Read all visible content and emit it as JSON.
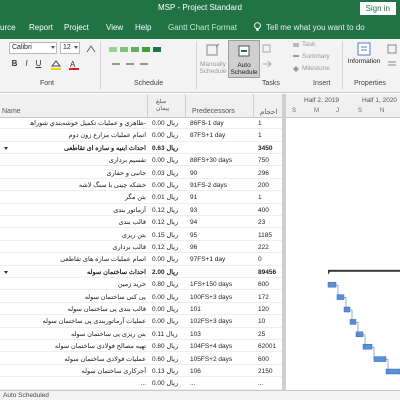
{
  "title": "MSP  -  Project Standard",
  "signin": "Sign in",
  "tabs": [
    "urce",
    "Report",
    "Project",
    "View",
    "Help",
    "Gantt Chart Format"
  ],
  "search_placeholder": "Tell me what you want to do",
  "ribbon": {
    "font_name": "Calibri",
    "font_size": "12",
    "manually_schedule": "Manually Schedule",
    "auto_schedule": "Auto Schedule",
    "task": "Task",
    "summary": "Summary",
    "milestone": "Milestone",
    "information": "Information",
    "groups": {
      "font": "Font",
      "schedule": "Schedule",
      "tasks": "Tasks",
      "insert": "Insert",
      "properties": "Properties"
    }
  },
  "columns": {
    "name": "Name",
    "duration": "مبلغ\nپیمان",
    "predecessors": "Predecessors",
    "cost": "احجام"
  },
  "timeline": {
    "half1": "Half 2, 2019",
    "half2": "Half 1, 2020",
    "days": [
      "S",
      "M",
      "J",
      "S",
      "N"
    ]
  },
  "rows": [
    {
      "name": "-ظاهري و عمليات تكميل خوشه‌بندي شوراهات",
      "dur": "ریال 0.00",
      "pred": "86FS-1 day",
      "cost": "1",
      "summary": false
    },
    {
      "name": "اتمام عملیات مزارع زون دوم",
      "dur": "ریال 0.00",
      "pred": "87FS+1 day",
      "cost": "1",
      "summary": false
    },
    {
      "name": "احداث ابنیه و سازه ای تقاطعی",
      "dur": "ریال 0.63",
      "pred": "",
      "cost": "3450",
      "summary": true
    },
    {
      "name": "تقسیم برداری",
      "dur": "ریال 0.00",
      "pred": "88FS+30 days",
      "cost": "750",
      "summary": false
    },
    {
      "name": "جانبی و حفاری",
      "dur": "ریال 0.03",
      "pred": "90",
      "cost": "296",
      "summary": false
    },
    {
      "name": "خشکه چینی با سنگ لاشه",
      "dur": "ریال 0.00",
      "pred": "91FS-2 days",
      "cost": "200",
      "summary": false
    },
    {
      "name": "بتن مگر",
      "dur": "ریال 0.01",
      "pred": "91",
      "cost": "1",
      "summary": false
    },
    {
      "name": "آرماتور بندی",
      "dur": "ریال 0.12",
      "pred": "93",
      "cost": "400",
      "summary": false
    },
    {
      "name": "قالب بندی",
      "dur": "ریال 0.12",
      "pred": "94",
      "cost": "23",
      "summary": false
    },
    {
      "name": "بتن ریزی",
      "dur": "ریال 0.15",
      "pred": "95",
      "cost": "1185",
      "summary": false
    },
    {
      "name": "قالب برداری",
      "dur": "ریال 0.12",
      "pred": "96",
      "cost": "222",
      "summary": false
    },
    {
      "name": "اتمام عملیات سازه های تقاطعی",
      "dur": "ریال 0.00",
      "pred": "97FS+1 day",
      "cost": "0",
      "summary": false
    },
    {
      "name": "احداث ساختمان سوله",
      "dur": "ریال 2.00",
      "pred": "",
      "cost": "89456",
      "summary": true
    },
    {
      "name": "خرید زمین",
      "dur": "ریال 0.80",
      "pred": "1FS+150 days",
      "cost": "600",
      "summary": false
    },
    {
      "name": "پی کنی ساختمان سوله",
      "dur": "ریال 0.00",
      "pred": "100FS+3 days",
      "cost": "172",
      "summary": false
    },
    {
      "name": "قالب بندی پی ساختمان سوله",
      "dur": "ریال 0.00",
      "pred": "101",
      "cost": "120",
      "summary": false
    },
    {
      "name": "عملیات آرماتوربندی پی ساختمان سوله",
      "dur": "ریال 0.00",
      "pred": "102FS+3 days",
      "cost": "10",
      "summary": false
    },
    {
      "name": "بتن ریزی پی ساختمان سوله",
      "dur": "ریال 0.11",
      "pred": "103",
      "cost": "25",
      "summary": false
    },
    {
      "name": "تهیه مصالح فولادی ساختمان سوله",
      "dur": "ریال 0.80",
      "pred": "104FS+4 days",
      "cost": "62001",
      "summary": false
    },
    {
      "name": "عملیات فولادی ساختمان سوله",
      "dur": "ریال 0.60",
      "pred": "105FS+2 days",
      "cost": "600",
      "summary": false
    },
    {
      "name": "آجرکاری ساختمان سوله",
      "dur": "ریال 0.13",
      "pred": "106",
      "cost": "2150",
      "summary": false
    },
    {
      "name": "...",
      "dur": "ریال 0.00",
      "pred": "...",
      "cost": "...",
      "summary": false
    }
  ],
  "status": "Auto Scheduled",
  "colors": {
    "accent": "#217346",
    "summary_bar": "#3a3a3a",
    "task_bar": "#5b8fd6"
  }
}
